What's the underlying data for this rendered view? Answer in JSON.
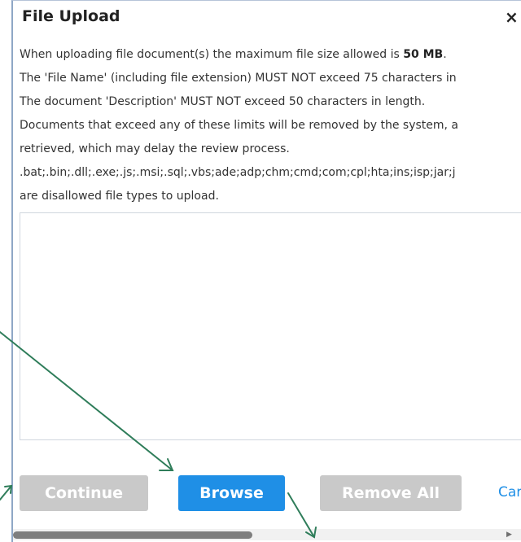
{
  "dialog": {
    "title": "File Upload",
    "close_glyph": "×",
    "info": {
      "line1_prefix": "When uploading file document(s) the maximum file size allowed is ",
      "line1_bold": "50 MB",
      "line1_suffix": ".",
      "line2": "The 'File Name' (including file extension) MUST NOT exceed 75 characters in",
      "line3": "The document 'Description' MUST NOT exceed 50 characters in length.",
      "line4": "Documents that exceed any of these limits will be removed by the system, a",
      "line5": "retrieved, which may delay the review process.",
      "line6": ".bat;.bin;.dll;.exe;.js;.msi;.sql;.vbs;ade;adp;chm;cmd;com;cpl;hta;ins;isp;jar;j",
      "line7": "are disallowed file types to upload."
    },
    "buttons": {
      "continue": "Continue",
      "browse": "Browse",
      "remove_all": "Remove All",
      "cancel": "Car"
    }
  },
  "colors": {
    "primary_button": "#1f8fe6",
    "disabled_button": "#c9c9c9",
    "link": "#1f8fe6",
    "annotation_arrow": "#2f7d5a"
  },
  "icons": {
    "close": "close-icon",
    "scroll_right": "scroll-right-arrow-icon"
  }
}
